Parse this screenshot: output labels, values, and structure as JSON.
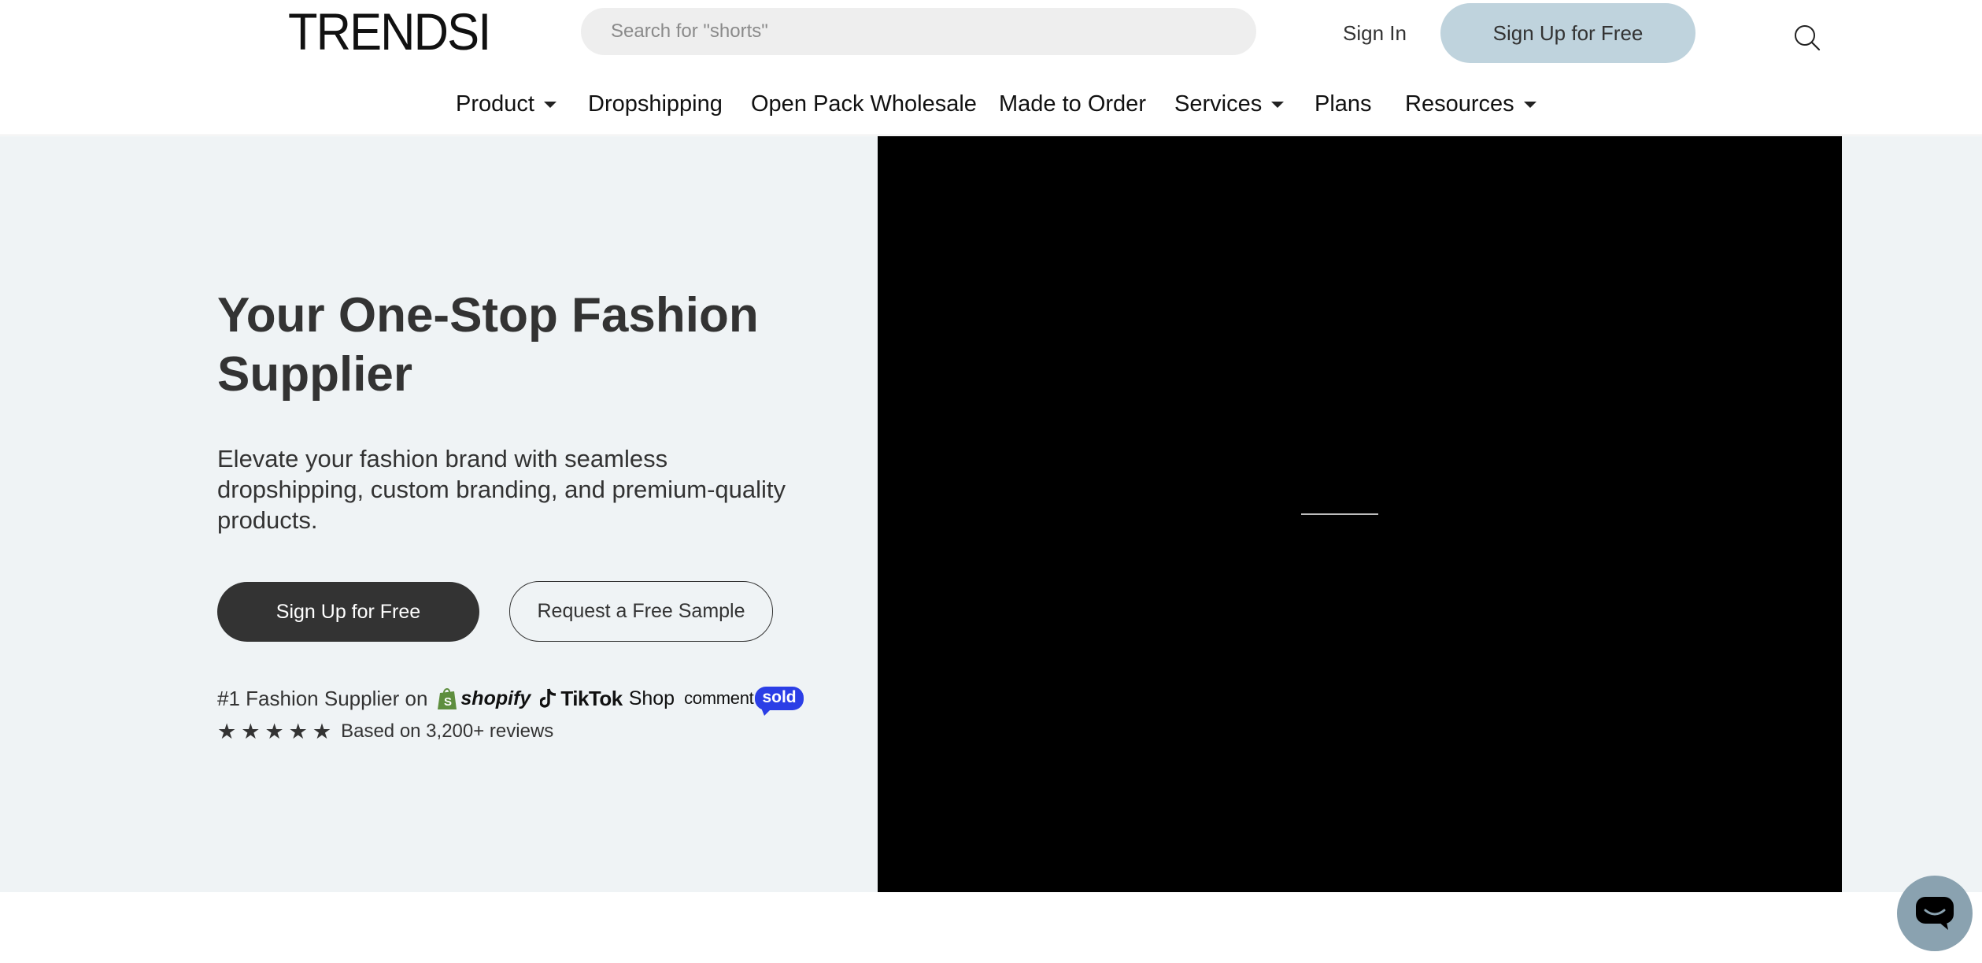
{
  "header": {
    "logo": "TRENDSI",
    "search": {
      "placeholder": "Search for \"shorts\"",
      "value": ""
    },
    "sign_in": "Sign In",
    "sign_up": "Sign Up for Free"
  },
  "nav": {
    "items": [
      {
        "label": "Product",
        "dropdown": true
      },
      {
        "label": "Dropshipping",
        "dropdown": false
      },
      {
        "label": "Open Pack Wholesale",
        "dropdown": false
      },
      {
        "label": "Made to Order",
        "dropdown": false
      },
      {
        "label": "Services",
        "dropdown": true
      },
      {
        "label": "Plans",
        "dropdown": false
      },
      {
        "label": "Resources",
        "dropdown": true
      }
    ]
  },
  "hero": {
    "title": "Your One-Stop Fashion Supplier",
    "subtitle": "Elevate your fashion brand with seamless dropshipping, custom branding, and premium-quality products.",
    "primary_cta": "Sign Up for Free",
    "secondary_cta": "Request a Free Sample",
    "supplier_text": "#1 Fashion Supplier on",
    "platforms": {
      "shopify": "shopify",
      "tiktok": "TikTok",
      "tiktok_shop": "Shop",
      "comment": "comment",
      "sold": "sold"
    },
    "rating": {
      "stars": 5,
      "text": "Based on 3,200+ reviews"
    }
  },
  "colors": {
    "hero_bg": "#eff3f5",
    "signup_top_bg": "#bfd3dd",
    "primary_button": "#333333",
    "commentsold_blue": "#2b3ee6",
    "chat_button": "#8aa2b0"
  },
  "icons": [
    "search-icon",
    "caret-down-icon",
    "shopify-bag-icon",
    "tiktok-note-icon",
    "star-icon",
    "chat-icon"
  ]
}
